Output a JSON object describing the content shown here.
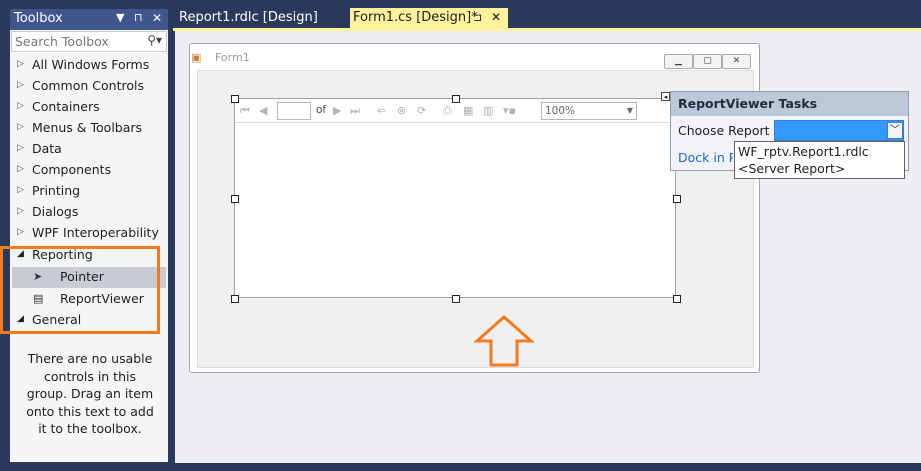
{
  "toolbox": {
    "title": "Toolbox",
    "search_placeholder": "Search Toolbox",
    "groups": [
      {
        "label": "All Windows Forms"
      },
      {
        "label": "Common Controls"
      },
      {
        "label": "Containers"
      },
      {
        "label": "Menus & Toolbars"
      },
      {
        "label": "Data"
      },
      {
        "label": "Components"
      },
      {
        "label": "Printing"
      },
      {
        "label": "Dialogs"
      },
      {
        "label": "WPF Interoperability"
      },
      {
        "label": "Reporting"
      }
    ],
    "reporting_items": [
      {
        "label": "Pointer"
      },
      {
        "label": "ReportViewer"
      }
    ],
    "general_label": "General",
    "empty_text": "There are no usable controls in this group. Drag an item onto this text to add it to the toolbox."
  },
  "tabs": [
    {
      "label": "Report1.rdlc [Design]"
    },
    {
      "label": "Form1.cs [Design]*"
    }
  ],
  "form": {
    "title": "Form1"
  },
  "report_viewer": {
    "of_label": "of",
    "zoom": "100%"
  },
  "tasks": {
    "title": "ReportViewer Tasks",
    "choose_label": "Choose Report",
    "dock_label": "Dock in Parent Container",
    "options": [
      "WF_rptv.Report1.rdlc",
      "<Server Report>"
    ]
  },
  "colors": {
    "chrome": "#2b3a5c",
    "toolbox_header": "#40568d",
    "active_tab": "#fff29d",
    "highlight": "#f47b20",
    "selection_blue": "#3399ff"
  }
}
